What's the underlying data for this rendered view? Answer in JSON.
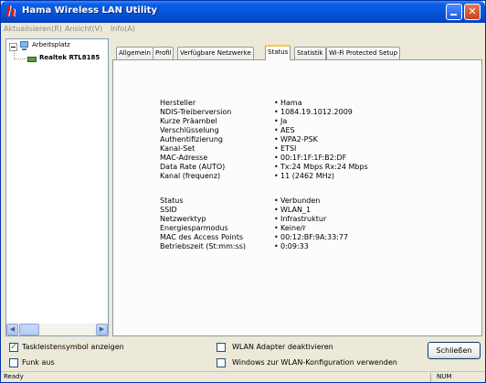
{
  "window": {
    "title": "Hama Wireless LAN Utility",
    "logo": "h"
  },
  "menu": [
    "Aktualisieren(R)",
    "Ansicht(V)",
    "Info(A)"
  ],
  "tree": {
    "root_label": "Arbeitsplatz",
    "child_label": "Realtek RTL8185"
  },
  "tabs": [
    "Allgemein",
    "Profil",
    "Verfügbare Netzwerke",
    "Status",
    "Statistik",
    "Wi-Fi Protected Setup"
  ],
  "active_tab": "Status",
  "status_info_1": [
    {
      "label": "Hersteller",
      "value": "Hama"
    },
    {
      "label": "NDIS-Treiberversion",
      "value": "1084.19.1012.2009"
    },
    {
      "label": "Kurze Präambel",
      "value": "Ja"
    },
    {
      "label": "Verschlüsselung",
      "value": "AES"
    },
    {
      "label": "Authentifizierung",
      "value": "WPA2-PSK"
    },
    {
      "label": "Kanal-Set",
      "value": "ETSI"
    },
    {
      "label": "MAC-Adresse",
      "value": "00:1F:1F:1F:B2:DF"
    },
    {
      "label": "Data Rate (AUTO)",
      "value": "Tx:24 Mbps Rx:24 Mbps"
    },
    {
      "label": "Kanal (frequenz)",
      "value": "11 (2462 MHz)"
    }
  ],
  "status_info_2": [
    {
      "label": "Status",
      "value": "Verbunden"
    },
    {
      "label": "SSID",
      "value": "WLAN_1"
    },
    {
      "label": "Netzwerktyp",
      "value": "Infrastruktur"
    },
    {
      "label": "Energiesparmodus",
      "value": "Keine/r"
    },
    {
      "label": "MAC des Access Points",
      "value": "00:12:BF:9A:33:77"
    },
    {
      "label": "Betriebszeit (St:mm:ss)",
      "value": "0:09:33"
    }
  ],
  "bottom": {
    "taskbar_icon_label": "Taskleistensymbol anzeigen",
    "taskbar_icon_checked": true,
    "radio_off_label": "Funk aus",
    "radio_off_checked": false,
    "disable_adapter_label": "WLAN Adapter deaktivieren",
    "disable_adapter_checked": false,
    "windows_config_label": "Windows zur WLAN-Konfiguration verwenden",
    "windows_config_checked": false,
    "close_button": "Schließen"
  },
  "statusbar": {
    "text": "Ready",
    "num": "NUM"
  }
}
